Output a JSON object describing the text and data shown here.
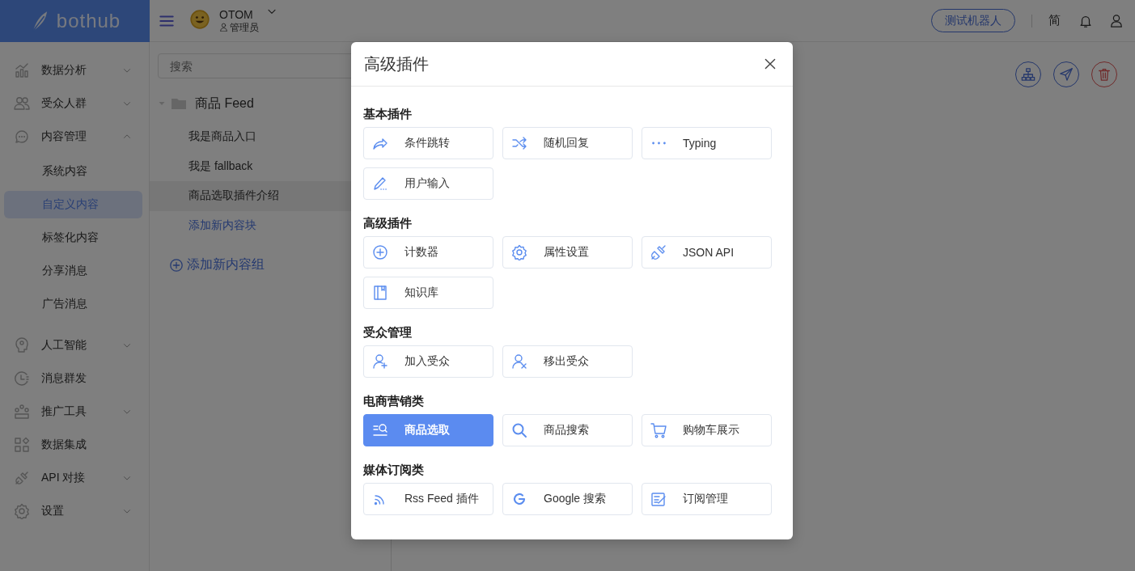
{
  "logo": {
    "text": "bothub"
  },
  "header": {
    "user": {
      "name": "OTOM",
      "role": "管理员"
    },
    "test_button": "测试机器人",
    "language": "简"
  },
  "sidebar": {
    "items": [
      {
        "label": "数据分析",
        "kind": "menu",
        "expanded": false,
        "selected": false
      },
      {
        "label": "受众人群",
        "kind": "menu",
        "expanded": false,
        "selected": false
      },
      {
        "label": "内容管理",
        "kind": "menu",
        "expanded": true,
        "selected": false,
        "children": [
          {
            "label": "系统内容",
            "selected": false
          },
          {
            "label": "自定义内容",
            "selected": true
          },
          {
            "label": "标签化内容",
            "selected": false
          },
          {
            "label": "分享消息",
            "selected": false
          },
          {
            "label": "广告消息",
            "selected": false
          }
        ]
      },
      {
        "label": "人工智能",
        "kind": "menu",
        "expanded": false,
        "selected": false
      },
      {
        "label": "消息群发",
        "kind": "link",
        "selected": false
      },
      {
        "label": "推广工具",
        "kind": "menu",
        "expanded": false,
        "selected": false
      },
      {
        "label": "数据集成",
        "kind": "link",
        "selected": false
      },
      {
        "label": "API 对接",
        "kind": "menu",
        "expanded": false,
        "selected": false
      },
      {
        "label": "设置",
        "kind": "menu",
        "expanded": false,
        "selected": false
      }
    ]
  },
  "content_tree": {
    "search": {
      "placeholder": "搜索"
    },
    "folders": [
      {
        "label": "商品 Feed",
        "expanded": true,
        "children": [
          {
            "label": "我是商品入口",
            "selected": false
          },
          {
            "label": "我是 fallback",
            "selected": false
          },
          {
            "label": "商品选取插件介绍",
            "selected": true
          }
        ],
        "add_block_link": "添加新内容块"
      }
    ],
    "add_group_link": "添加新内容组"
  },
  "dialog": {
    "title": "高级插件",
    "sections": [
      {
        "title": "基本插件",
        "plugins": [
          {
            "label": "条件跳转",
            "selected": false
          },
          {
            "label": "随机回复",
            "selected": false
          },
          {
            "label": "Typing",
            "selected": false
          },
          {
            "label": "用户输入",
            "selected": false
          }
        ]
      },
      {
        "title": "高级插件",
        "plugins": [
          {
            "label": "计数器",
            "selected": false
          },
          {
            "label": "属性设置",
            "selected": false
          },
          {
            "label": "JSON API",
            "selected": false
          },
          {
            "label": "知识库",
            "selected": false
          }
        ]
      },
      {
        "title": "受众管理",
        "plugins": [
          {
            "label": "加入受众",
            "selected": false
          },
          {
            "label": "移出受众",
            "selected": false
          }
        ]
      },
      {
        "title": "电商营销类",
        "plugins": [
          {
            "label": "商品选取",
            "selected": true
          },
          {
            "label": "商品搜索",
            "selected": false
          },
          {
            "label": "购物车展示",
            "selected": false
          }
        ]
      },
      {
        "title": "媒体订阅类",
        "plugins": [
          {
            "label": "Rss Feed 插件",
            "selected": false
          },
          {
            "label": "Google 搜索",
            "selected": false
          },
          {
            "label": "订阅管理",
            "selected": false
          }
        ]
      }
    ]
  }
}
